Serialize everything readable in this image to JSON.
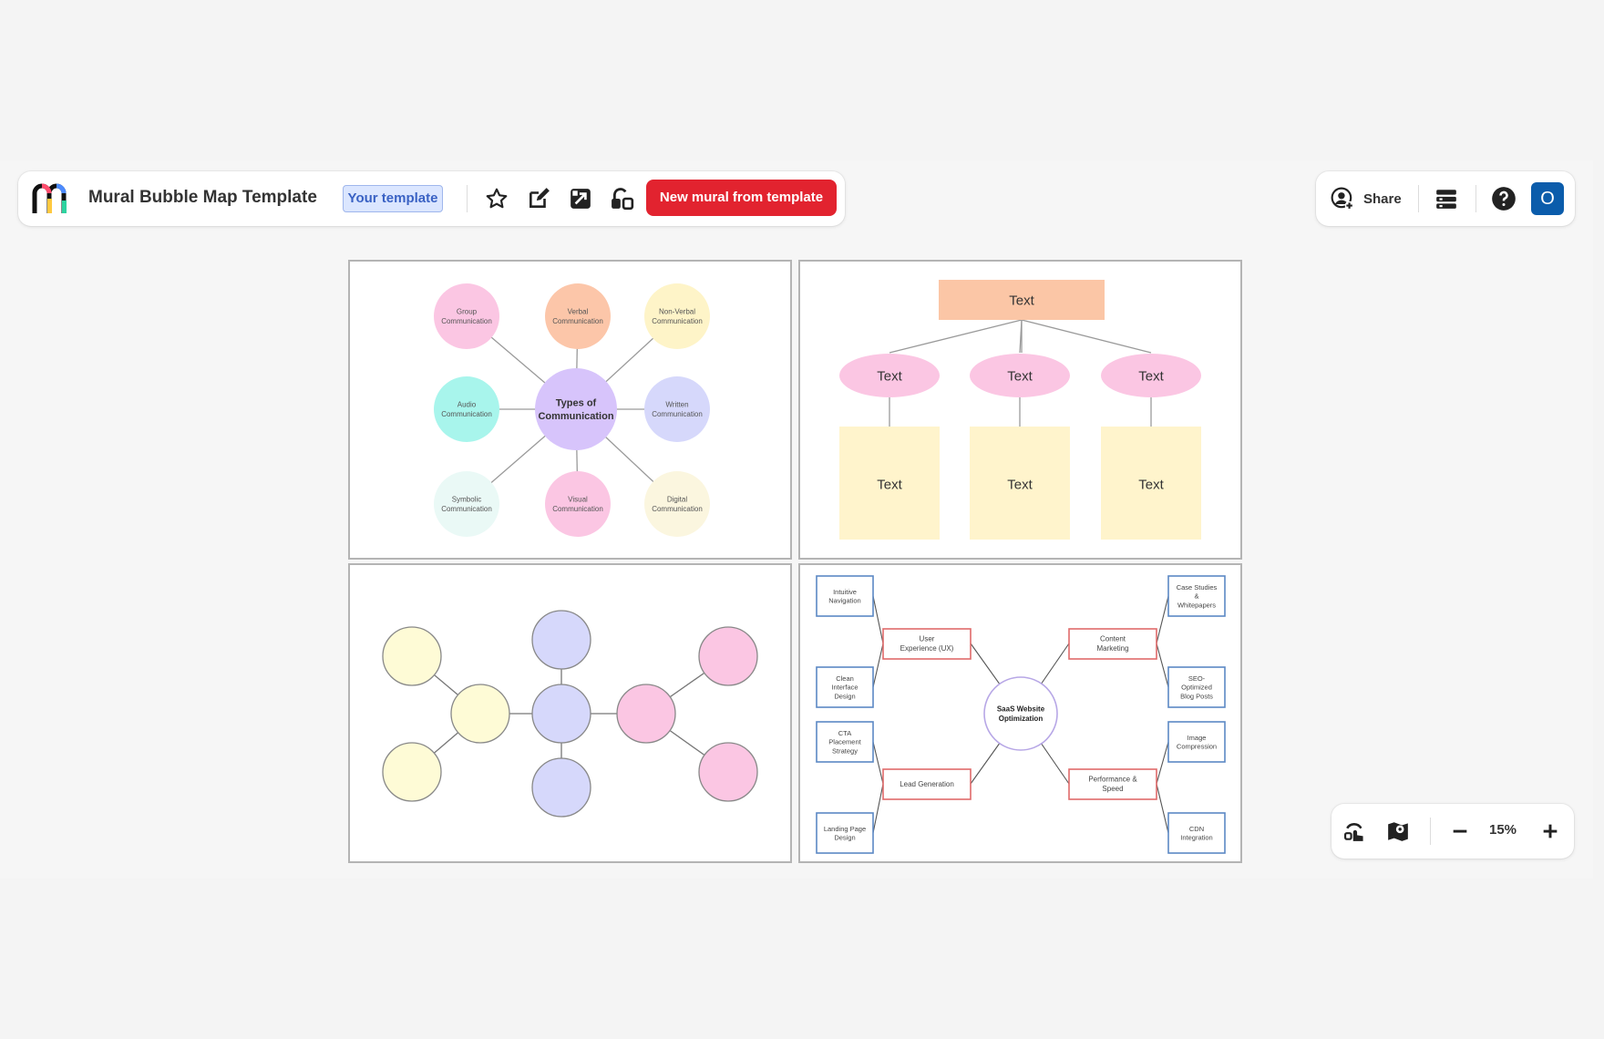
{
  "header": {
    "title": "Mural Bubble Map Template",
    "badge": "Your template",
    "cta": "New mural from template",
    "share": "Share",
    "avatar": "O"
  },
  "zoom": {
    "level": "15%"
  },
  "panel1": {
    "center": "Types of Communication",
    "center_lines": [
      "Types of",
      "Communication"
    ],
    "nodes": [
      {
        "lines": [
          "Group",
          "Communication"
        ],
        "color": "#fbc6e3"
      },
      {
        "lines": [
          "Verbal",
          "Communication"
        ],
        "color": "#fcc6a9"
      },
      {
        "lines": [
          "Non-Verbal",
          "Communication"
        ],
        "color": "#fef4c8"
      },
      {
        "lines": [
          "Audio",
          "Communication"
        ],
        "color": "#a8f5ec"
      },
      {
        "lines": [
          "Written",
          "Communication"
        ],
        "color": "#d6d8fb"
      },
      {
        "lines": [
          "Symbolic",
          "Communication"
        ],
        "color": "#eaf9f6"
      },
      {
        "lines": [
          "Visual",
          "Communication"
        ],
        "color": "#fbc6e3"
      },
      {
        "lines": [
          "Digital",
          "Communication"
        ],
        "color": "#fbf6df"
      }
    ],
    "center_color": "#d7c4fb"
  },
  "panel2": {
    "top": "Text",
    "ovals": [
      "Text",
      "Text",
      "Text"
    ],
    "boxes": [
      "Text",
      "Text",
      "Text"
    ],
    "top_color": "#fbc6a6",
    "oval_color": "#fbc6e3",
    "box_color": "#fff4cc"
  },
  "panel3": {
    "yellow": "#fefbd6",
    "lavender": "#d6d8fb",
    "pink": "#fbc6e3"
  },
  "panel4": {
    "center_lines": [
      "SaaS Website",
      "Optimization"
    ],
    "mid_nodes": [
      {
        "lines": [
          "User",
          "Experience (UX)"
        ]
      },
      {
        "lines": [
          "Content",
          "Marketing"
        ]
      },
      {
        "lines": [
          "Lead Generation"
        ]
      },
      {
        "lines": [
          "Performance &",
          "Speed"
        ]
      }
    ],
    "leaves": [
      {
        "lines": [
          "Intuitive",
          "Navigation"
        ]
      },
      {
        "lines": [
          "Clean",
          "Interface",
          "Design"
        ]
      },
      {
        "lines": [
          "CTA",
          "Placement",
          "Strategy"
        ]
      },
      {
        "lines": [
          "Landing Page",
          "Design"
        ]
      },
      {
        "lines": [
          "Case Studies",
          "&",
          "Whitepapers"
        ]
      },
      {
        "lines": [
          "SEO-",
          "Optimized",
          "Blog Posts"
        ]
      },
      {
        "lines": [
          "Image",
          "Compression"
        ]
      },
      {
        "lines": [
          "CDN",
          "Integration"
        ]
      }
    ],
    "mid_border": "#e06b6b",
    "leaf_border": "#5b88c4"
  }
}
